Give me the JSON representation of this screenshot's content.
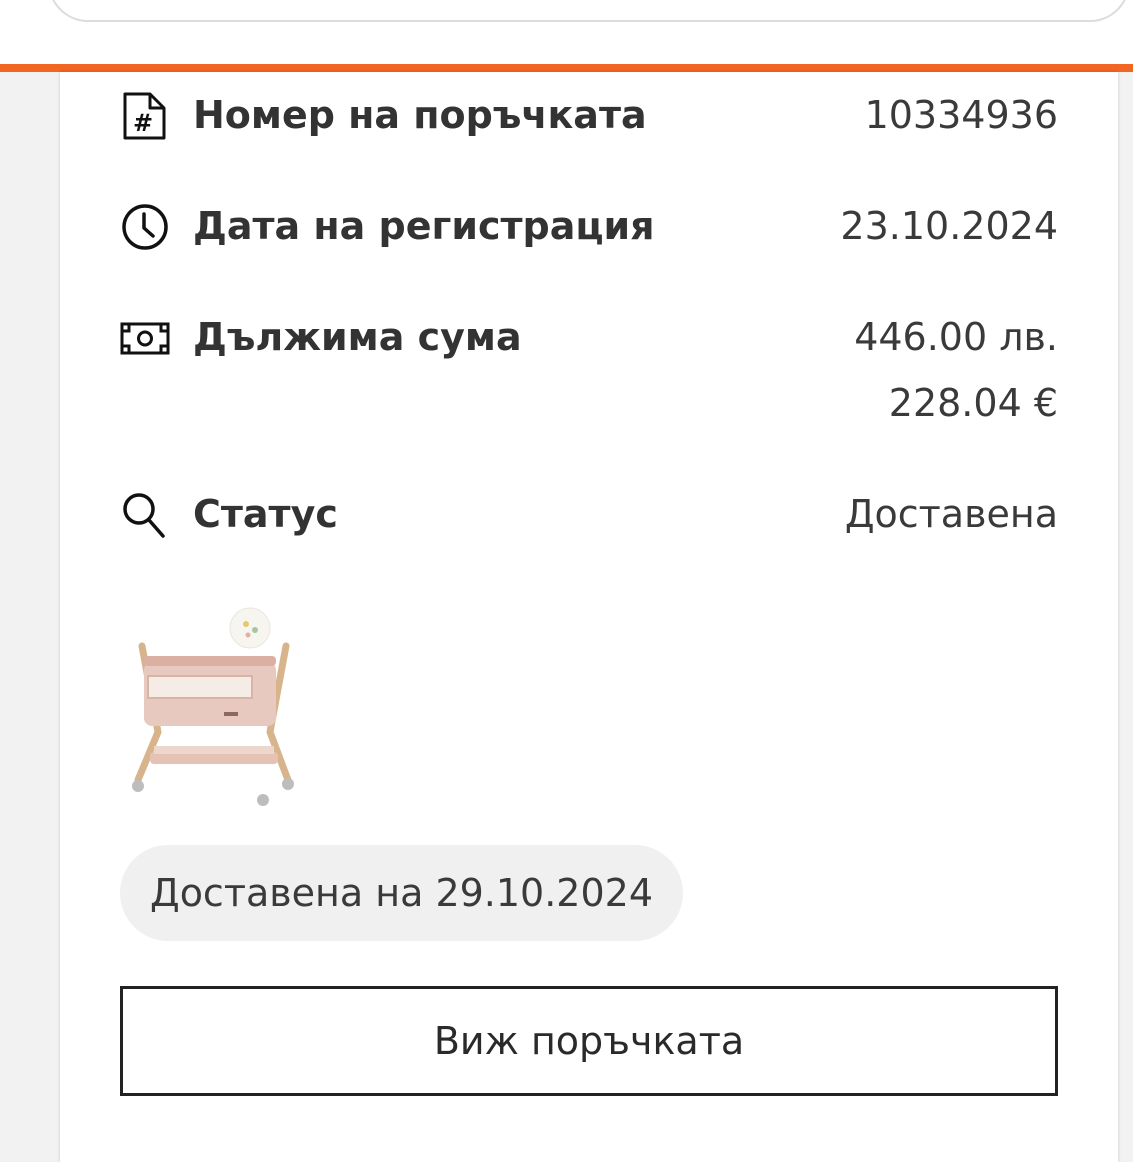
{
  "order": {
    "rows": [
      {
        "icon": "document-hash-icon",
        "label": "Номер на поръчката",
        "value": "10334936"
      },
      {
        "icon": "clock-icon",
        "label": "Дата на регистрация",
        "value": "23.10.2024"
      },
      {
        "icon": "banknote-icon",
        "label": "Дължима сума",
        "value": "446.00 лв.",
        "value_secondary": "228.04 €"
      },
      {
        "icon": "search-icon",
        "label": "Статус",
        "value": "Доставена"
      }
    ],
    "delivered_badge": "Доставена на 29.10.2024",
    "view_button_label": "Виж поръчката"
  },
  "colors": {
    "accent": "#f26522",
    "background": "#f2f2f2",
    "card": "#ffffff",
    "pill": "#f0f0f0"
  }
}
